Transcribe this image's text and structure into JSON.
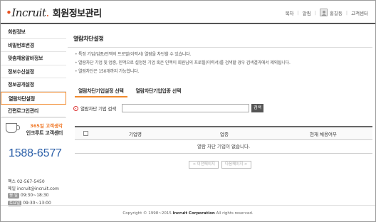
{
  "header": {
    "logo_text": "Incruit",
    "title": "회원정보관리",
    "nav": [
      "목차",
      "알림"
    ],
    "user_name": "홍길동",
    "customer_center": "고객센터"
  },
  "sidebar": {
    "items": [
      {
        "label": "회원정보",
        "active": false
      },
      {
        "label": "비밀번호변경",
        "active": false
      },
      {
        "label": "맞춤채용알바정보",
        "active": false
      },
      {
        "label": "정보수신설정",
        "active": false
      },
      {
        "label": "정보공개설정",
        "active": false
      },
      {
        "label": "열람차단설정",
        "active": true
      },
      {
        "label": "간편로그인관리",
        "active": false
      }
    ],
    "cs": {
      "hours_badge": "365일 고객생각",
      "center": "인크루트 고객센터",
      "phone": "1588-6577",
      "fax": "팩스 02-567-5450",
      "email": "메일 incruit@incruit.com",
      "weekday_tag": "평 일",
      "weekday_hours": "09:30~18:30",
      "saturday_tag": "토요일",
      "saturday_hours": "09:30~13:00"
    }
  },
  "main": {
    "title": "열람차단설정",
    "notices": [
      "특정 기업/업종/인맥의 프로필(이력서) 열람을 차단할 수 있습니다.",
      "열람차단 기업 및 업종, 인맥으로 설정된 기업 혹은 인맥이 회원님의 프로필(이력서)를 검색할 경우 검색결과에서 제외됩니다.",
      "열람차단은 150개까지 가능합니다."
    ],
    "tabs": [
      {
        "label": "열람차단기업설정 선택",
        "active": true
      },
      {
        "label": "열람차단기업업종 선택",
        "active": false
      }
    ],
    "search": {
      "label": "열람차단 기업 검색",
      "placeholder": "",
      "button": "검색"
    },
    "table": {
      "headers": [
        "기업명",
        "업종",
        "현재 채용여부"
      ],
      "empty_message": "열람 차단 기업이 없습니다."
    },
    "pager": {
      "prev": "< 이전페이지",
      "next": "다음페이지 >"
    }
  },
  "footer": {
    "copyright": "Copyright © 1998~2015",
    "company": "Incruit Corporation",
    "rights": "All rights reserved."
  },
  "colors": {
    "accent": "#f28a2c",
    "phone": "#2b5fa8"
  }
}
